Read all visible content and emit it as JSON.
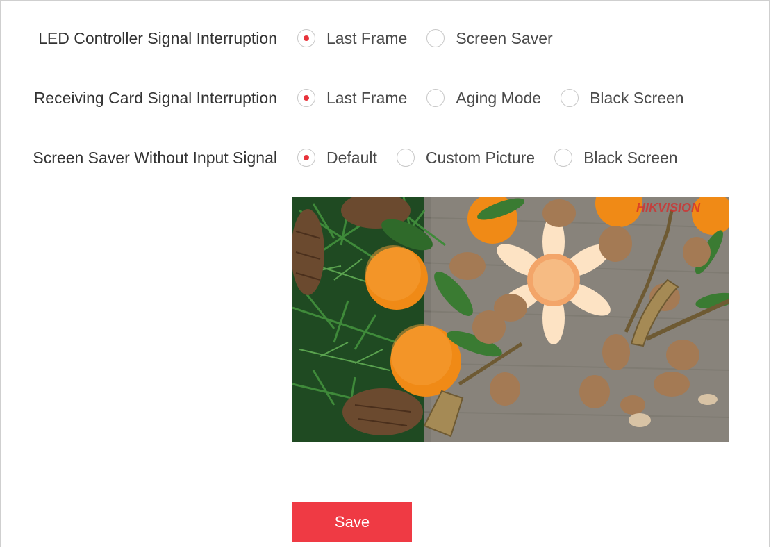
{
  "settings": [
    {
      "label": "LED Controller Signal Interruption",
      "options": [
        {
          "label": "Last Frame",
          "checked": true
        },
        {
          "label": "Screen Saver",
          "checked": false
        }
      ]
    },
    {
      "label": "Receiving Card Signal Interruption",
      "options": [
        {
          "label": "Last Frame",
          "checked": true
        },
        {
          "label": "Aging Mode",
          "checked": false
        },
        {
          "label": "Black Screen",
          "checked": false
        }
      ]
    },
    {
      "label": "Screen Saver Without Input Signal",
      "options": [
        {
          "label": "Default",
          "checked": true
        },
        {
          "label": "Custom Picture",
          "checked": false
        },
        {
          "label": "Black Screen",
          "checked": false
        }
      ]
    }
  ],
  "preview": {
    "watermark": "HIKVISION"
  },
  "save_label": "Save",
  "colors": {
    "accent": "#ef3a44",
    "radio_dot": "#e8333b"
  }
}
